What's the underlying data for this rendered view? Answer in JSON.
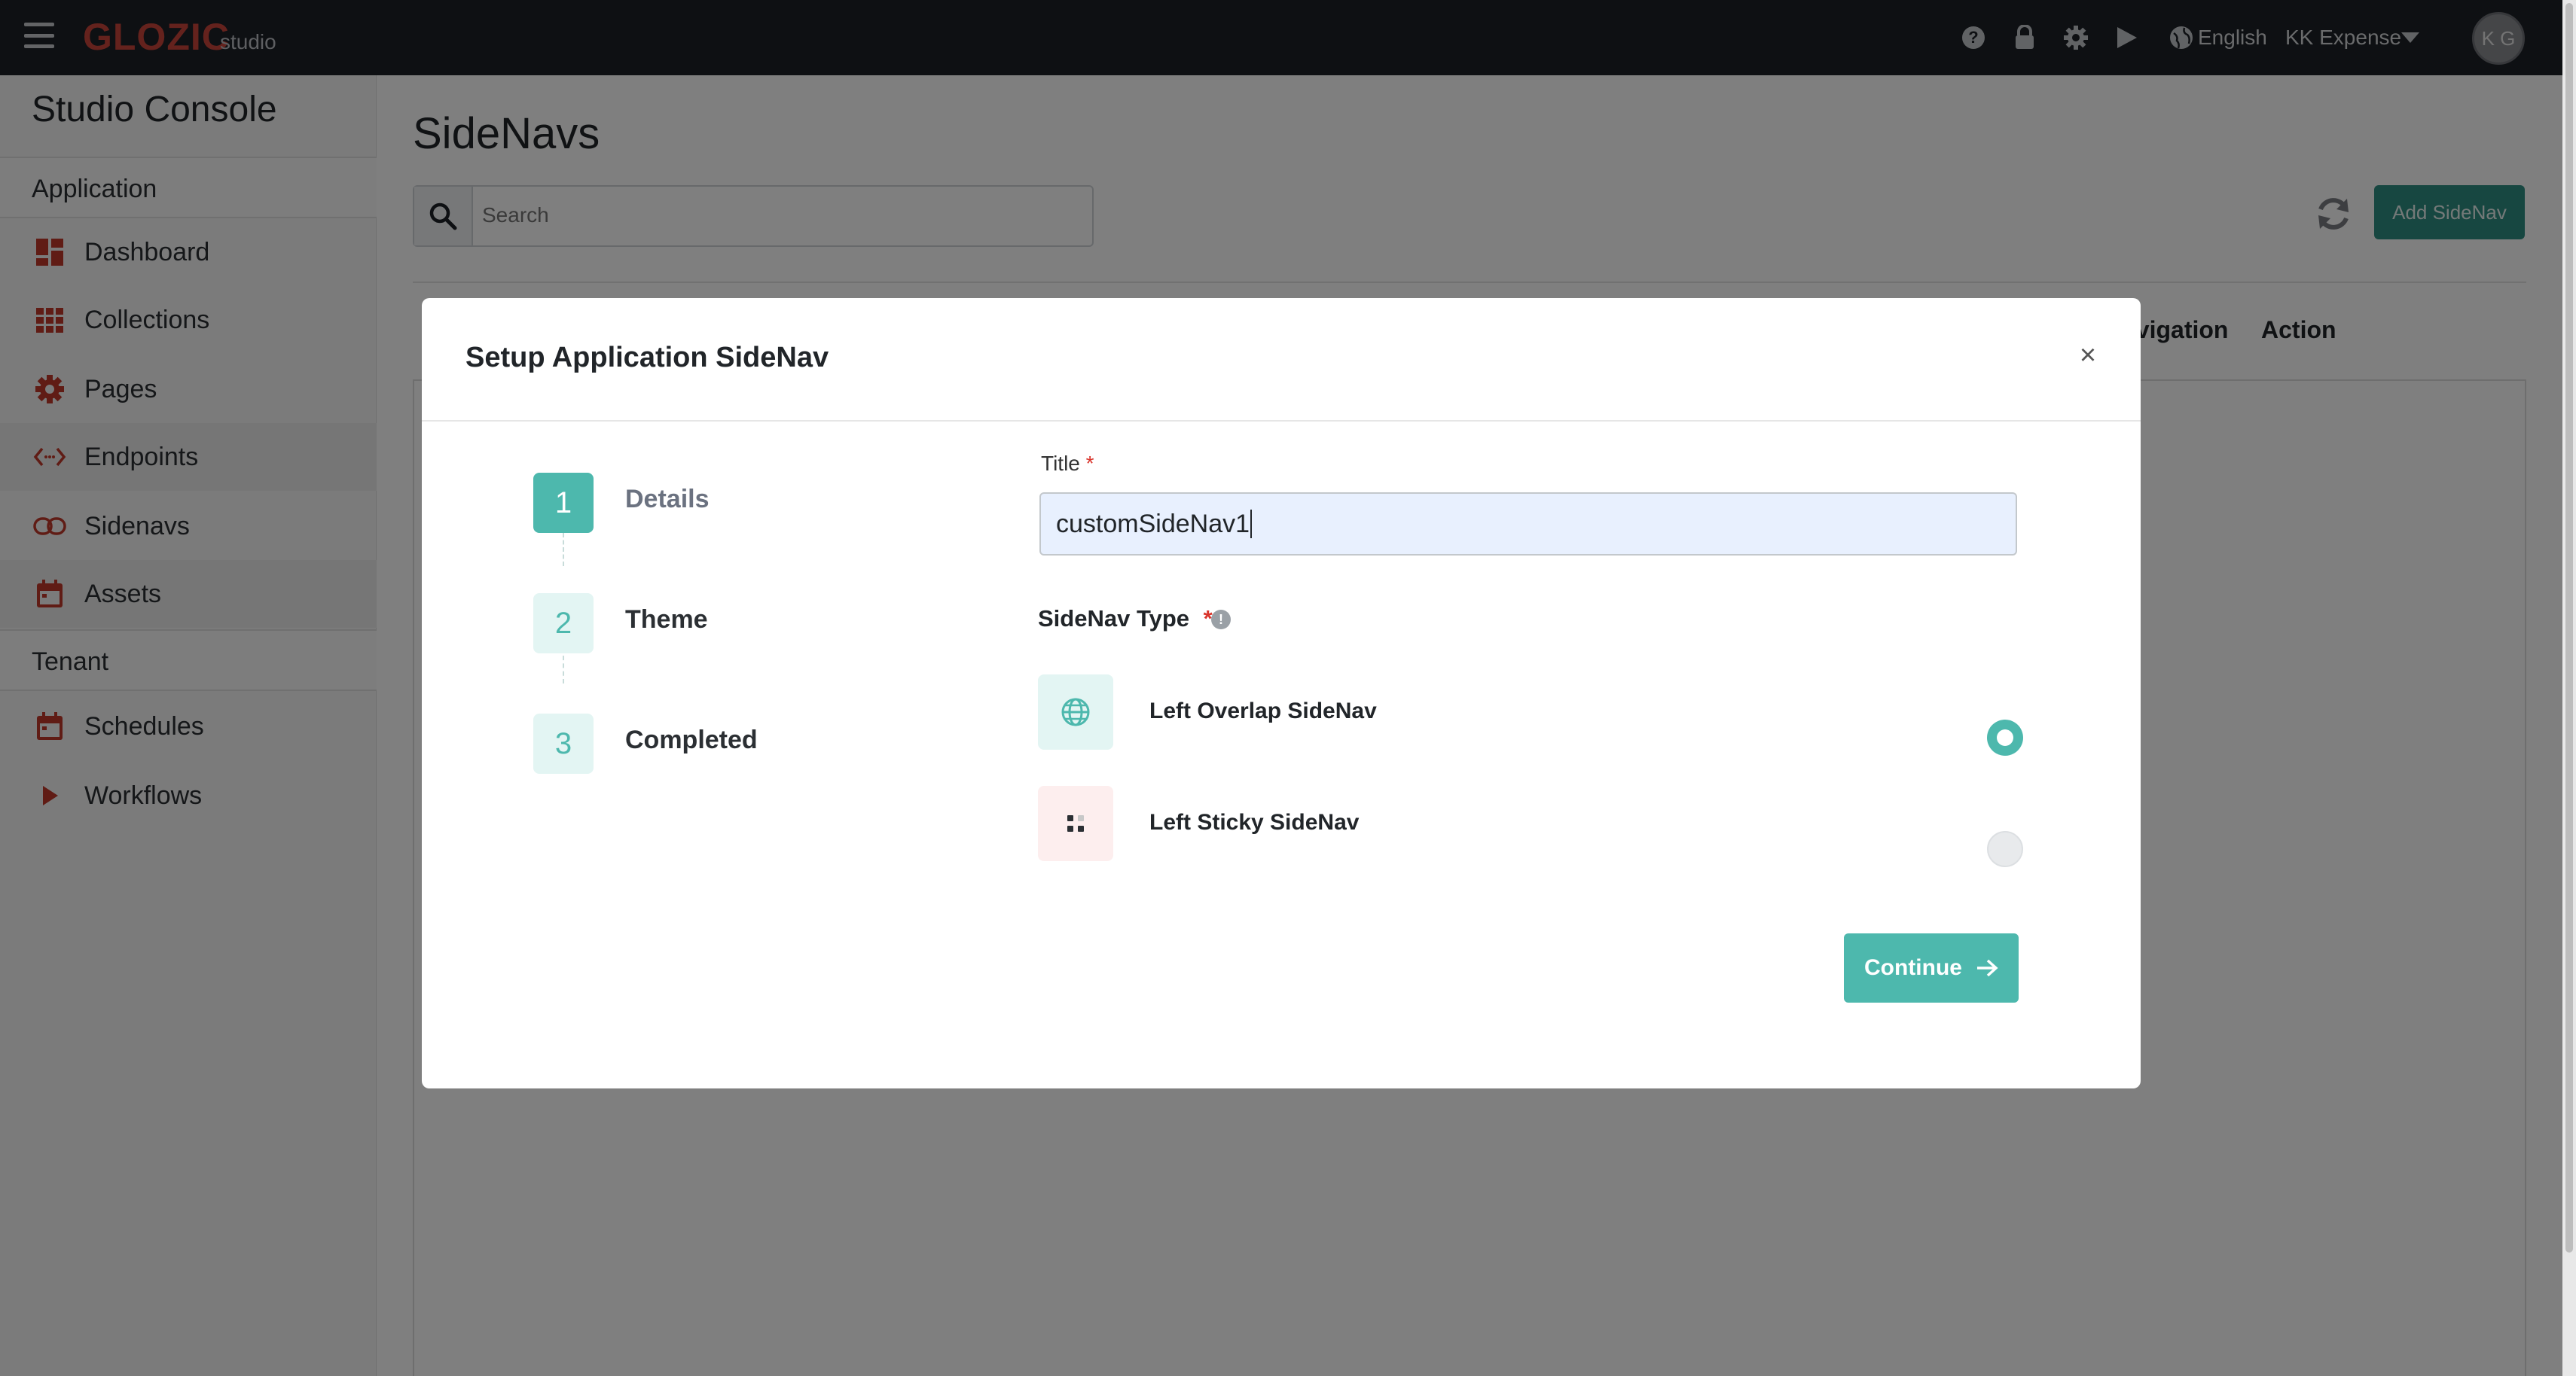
{
  "topbar": {
    "logo": "GLOZIC",
    "logo_sub": "studio",
    "language": "English",
    "tenant": "KK Expense",
    "avatar_initials": "K G",
    "icons": [
      "help-icon",
      "lock-icon",
      "gear-icon",
      "play-icon",
      "globe-icon",
      "caret-down-icon"
    ]
  },
  "sidebar": {
    "title": "Studio Console",
    "sections": [
      {
        "label": "Application",
        "items": [
          {
            "label": "Dashboard",
            "icon": "dashboard-icon"
          },
          {
            "label": "Collections",
            "icon": "grid-icon"
          },
          {
            "label": "Pages",
            "icon": "gear-icon"
          },
          {
            "label": "Endpoints",
            "icon": "code-icon"
          },
          {
            "label": "Sidenavs",
            "icon": "link-icon"
          },
          {
            "label": "Assets",
            "icon": "calendar-icon"
          }
        ]
      },
      {
        "label": "Tenant",
        "items": [
          {
            "label": "Schedules",
            "icon": "calendar-icon"
          },
          {
            "label": "Workflows",
            "icon": "play-icon"
          }
        ]
      }
    ]
  },
  "main": {
    "title": "SideNavs",
    "search_placeholder": "Search",
    "add_button": "Add SideNav",
    "columns_visible": [
      "avigation",
      "Action"
    ]
  },
  "modal": {
    "title": "Setup Application SideNav",
    "close_symbol": "×",
    "steps": [
      {
        "number": "1",
        "label": "Details",
        "active": true
      },
      {
        "number": "2",
        "label": "Theme",
        "active": false
      },
      {
        "number": "3",
        "label": "Completed",
        "active": false
      }
    ],
    "title_field": {
      "label": "Title",
      "required_mark": "*",
      "value": "customSideNav1"
    },
    "type_field": {
      "label": "SideNav Type",
      "required_mark": "*",
      "info_symbol": "!",
      "options": [
        {
          "label": "Left Overlap SideNav",
          "icon": "globe-icon",
          "selected": true
        },
        {
          "label": "Left Sticky SideNav",
          "icon": "dots-grid-icon",
          "selected": false
        }
      ]
    },
    "continue_button": "Continue"
  },
  "colors": {
    "accent": "#4db8ad",
    "topbar": "#1c2127",
    "logo": "#c8453a",
    "add_button": "#2f8f83"
  }
}
